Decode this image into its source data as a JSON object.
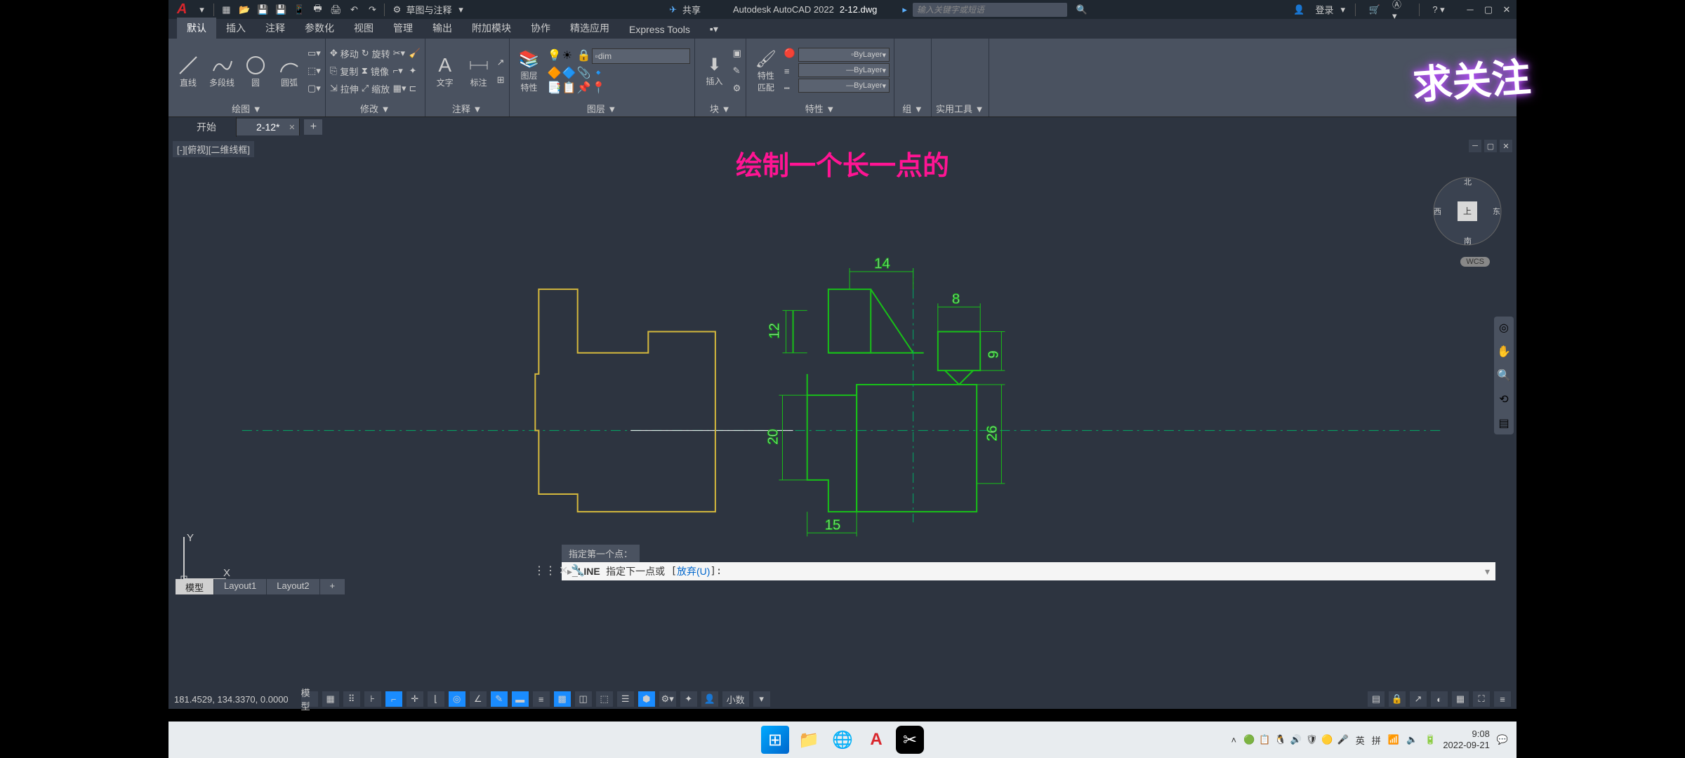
{
  "title": {
    "app": "Autodesk AutoCAD 2022",
    "file": "2-12.dwg",
    "share": "共享",
    "login": "登录",
    "search_placeholder": "输入关键字或短语",
    "workspace_dd": "草图与注释"
  },
  "ribbon_tabs": [
    "默认",
    "插入",
    "注释",
    "参数化",
    "视图",
    "管理",
    "输出",
    "附加模块",
    "协作",
    "精选应用",
    "Express Tools"
  ],
  "panels": {
    "draw": {
      "label": "绘图 ▼",
      "line": "直线",
      "polyline": "多段线",
      "circle": "圆",
      "arc": "圆弧"
    },
    "modify": {
      "label": "修改 ▼",
      "move": "移动",
      "rotate": "旋转",
      "copy": "复制",
      "mirror": "镜像",
      "stretch": "拉伸",
      "scale": "缩放"
    },
    "annot": {
      "label": "注释 ▼",
      "text": "文字",
      "dim": "标注"
    },
    "layers": {
      "label": "图层 ▼",
      "props": "图层\n特性",
      "current": "dim"
    },
    "block": {
      "label": "块 ▼",
      "insert": "插入"
    },
    "props": {
      "label": "特性 ▼",
      "btn": "特性\n匹配",
      "bylayer": "ByLayer"
    },
    "group": {
      "label": "组 ▼"
    },
    "util": {
      "label": "实用工具 ▼"
    }
  },
  "file_tabs": {
    "start": "开始",
    "current": "2-12*"
  },
  "viewport": {
    "label": "[-][俯视][二维线框]",
    "wcs": "WCS",
    "cube": {
      "n": "北",
      "s": "南",
      "e": "东",
      "w": "西",
      "top": "上"
    }
  },
  "overlay": "绘制一个长一点的",
  "watermark": "求关注",
  "ucs": {
    "x": "X",
    "y": "Y"
  },
  "dims": {
    "d14": "14",
    "d8": "8",
    "d12": "12",
    "d9": "9",
    "d20": "20",
    "d26": "26",
    "d15": "15"
  },
  "cmd": {
    "history": "指定第一个点：",
    "prefix": "LINE",
    "prompt": "指定下一点或",
    "opt": "放弃(U)"
  },
  "layout_tabs": [
    "模型",
    "Layout1",
    "Layout2"
  ],
  "status": {
    "coords": "181.4529, 134.3370, 0.0000",
    "model": "模型",
    "decimal": "小数"
  },
  "taskbar": {
    "ime1": "英",
    "ime2": "拼",
    "time": "9:08",
    "date": "2022-09-21"
  }
}
